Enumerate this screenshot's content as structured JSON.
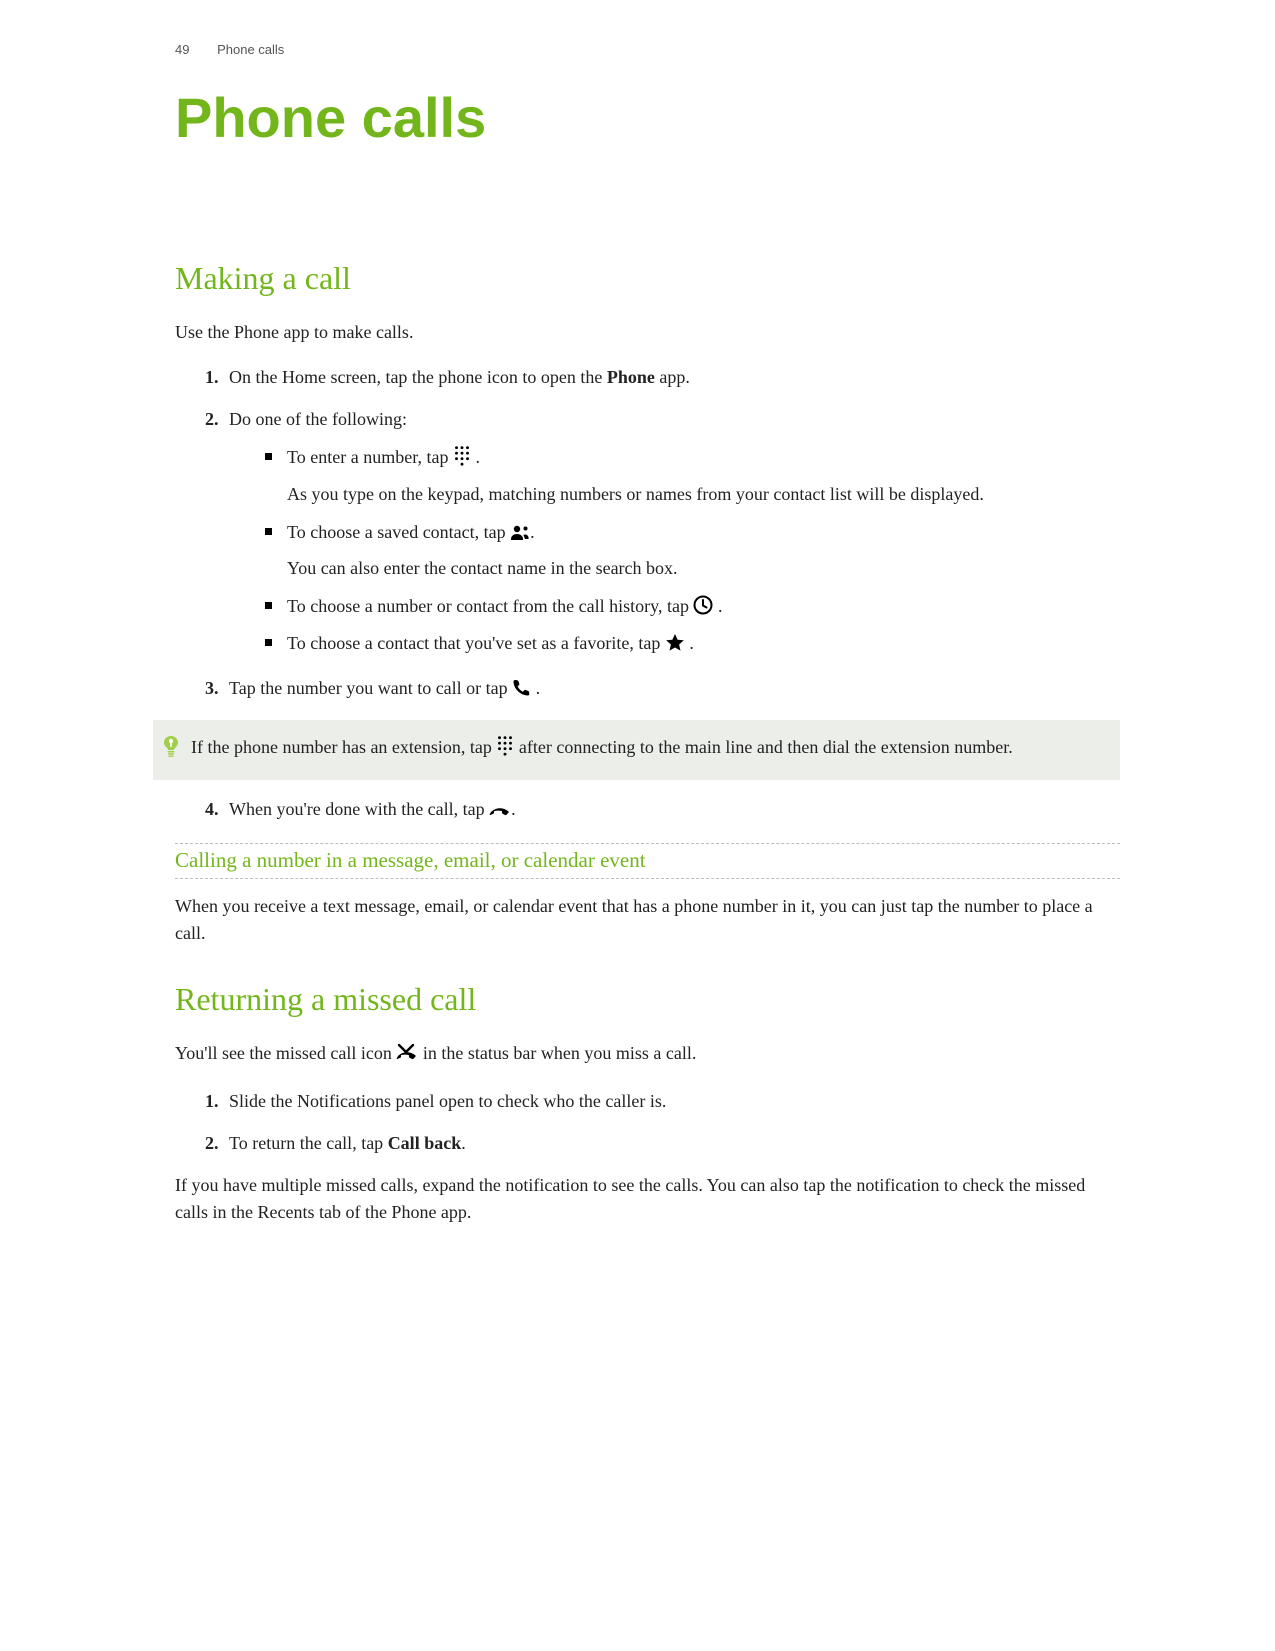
{
  "header": {
    "page_number": "49",
    "running_title": "Phone calls"
  },
  "chapter_title": "Phone calls",
  "section1": {
    "title": "Making a call",
    "intro": "Use the Phone app to make calls.",
    "step1_a": "On the Home screen, tap the phone icon to open the ",
    "step1_bold": "Phone",
    "step1_b": " app.",
    "step2": "Do one of the following:",
    "b1_a": "To enter a number, tap ",
    "b1_b": " .",
    "b1_note": "As you type on the keypad, matching numbers or names from your contact list will be displayed.",
    "b2_a": "To choose a saved contact, tap ",
    "b2_b": ".",
    "b2_note": "You can also enter the contact name in the search box.",
    "b3_a": "To choose a number or contact from the call history, tap ",
    "b3_b": " .",
    "b4_a": "To choose a contact that you've set as a favorite, tap ",
    "b4_b": " .",
    "step3_a": "Tap the number you want to call or tap ",
    "step3_b": " .",
    "tip_a": "If the phone number has an extension, tap ",
    "tip_b": " after connecting to the main line and then dial the extension number.",
    "step4_a": "When you're done with the call, tap ",
    "step4_b": "."
  },
  "sub1": {
    "title": "Calling a number in a message, email, or calendar event",
    "body": "When you receive a text message, email, or calendar event that has a phone number in it, you can just tap the number to place a call."
  },
  "section2": {
    "title": "Returning a missed call",
    "intro_a": "You'll see the missed call icon ",
    "intro_b": " in the status bar when you miss a call.",
    "step1": "Slide the Notifications panel open to check who the caller is.",
    "step2_a": "To return the call, tap ",
    "step2_bold": "Call back",
    "step2_b": ".",
    "outro": "If you have multiple missed calls, expand the notification to see the calls. You can also tap the notification to check the missed calls in the Recents tab of the Phone app."
  }
}
